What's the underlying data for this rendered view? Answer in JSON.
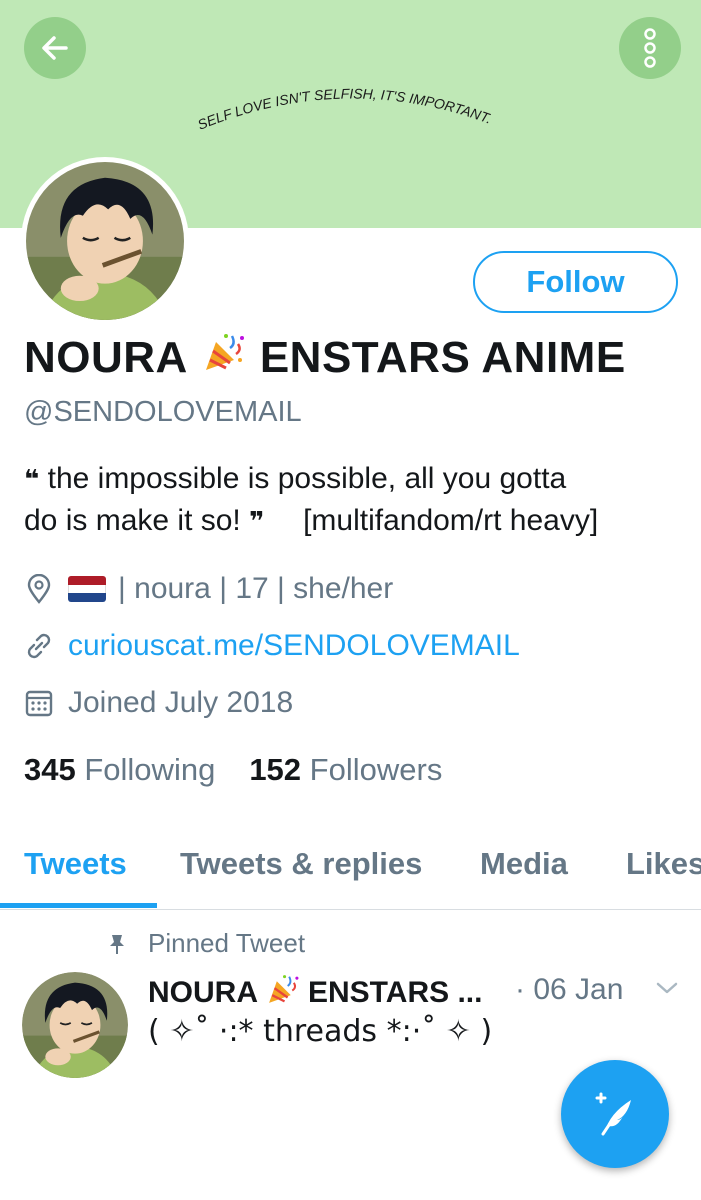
{
  "banner": {
    "color": "#bfe8b6",
    "text": "SELF LOVE ISN'T SELFISH, IT'S IMPORTANT."
  },
  "icons": {
    "back": "arrow-left-icon",
    "more": "more-vertical-icon",
    "location": "location-pin-icon",
    "link": "link-icon",
    "calendar": "calendar-icon",
    "pin": "pin-icon",
    "party": "party-popper-icon",
    "compose": "compose-feather-icon"
  },
  "profile": {
    "name_first": "NOURA",
    "name_second": "ENSTARS ANIME",
    "handle": "@SENDOLOVEMAIL",
    "bio_line1": "the impossible is possible, all you gotta",
    "bio_line2_a": "do is make it so!",
    "bio_line2_b": "[multifandom/rt heavy]",
    "open_quote": "❝",
    "close_quote": "❞",
    "location": "| noura | 17 | she/her",
    "website": "curiouscat.me/SENDOLOVEMAIL",
    "joined": "Joined July 2018"
  },
  "follow_label": "Follow",
  "stats": {
    "following_count": "345",
    "following_label": "Following",
    "followers_count": "152",
    "followers_label": "Followers"
  },
  "tabs": [
    "Tweets",
    "Tweets & replies",
    "Media",
    "Likes"
  ],
  "active_tab": "Tweets",
  "pinned": {
    "label": "Pinned Tweet",
    "name_first": "NOURA",
    "name_second": "ENSTARS ...",
    "date": "· 06 Jan",
    "text": "( ✧˚ ·:* threads *:·˚ ✧ )"
  },
  "colors": {
    "accent": "#1da1f2",
    "secondary_text": "#657786",
    "primary_text": "#14171a",
    "banner_button": "#93cf8a"
  }
}
